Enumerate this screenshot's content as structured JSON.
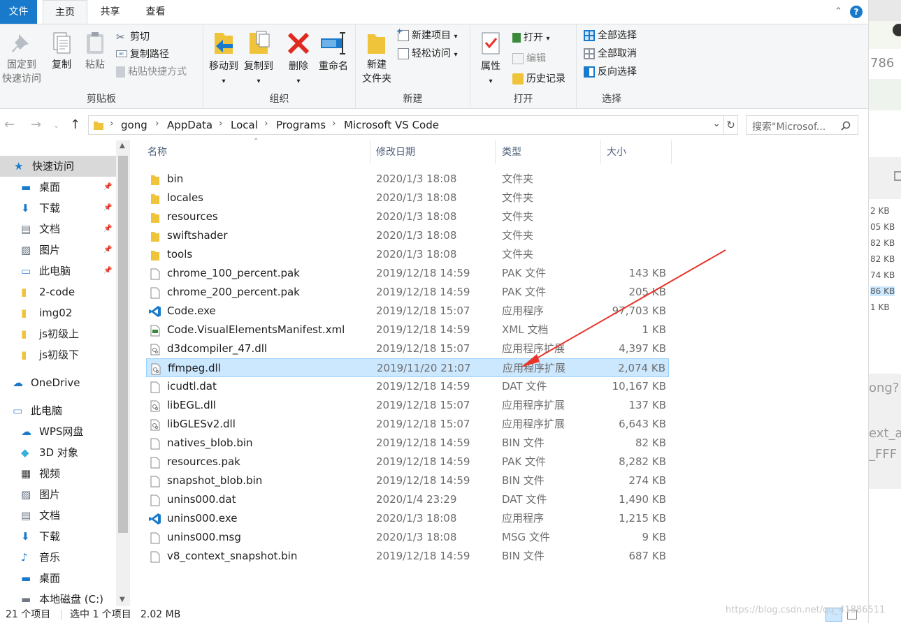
{
  "tabs": {
    "file": "文件",
    "home": "主页",
    "share": "共享",
    "view": "查看"
  },
  "ribbon": {
    "clipboard": {
      "title": "剪贴板",
      "pin_line1": "固定到",
      "pin_line2": "快速访问",
      "copy": "复制",
      "paste": "粘贴",
      "cut": "剪切",
      "copy_path": "复制路径",
      "paste_shortcut": "粘贴快捷方式"
    },
    "organize": {
      "title": "组织",
      "move_to": "移动到",
      "copy_to": "复制到",
      "delete": "删除",
      "rename": "重命名"
    },
    "new": {
      "title": "新建",
      "new_folder_line1": "新建",
      "new_folder_line2": "文件夹",
      "new_item": "新建项目",
      "easy_access": "轻松访问"
    },
    "open": {
      "title": "打开",
      "properties": "属性",
      "open": "打开",
      "edit": "编辑",
      "history": "历史记录"
    },
    "select": {
      "title": "选择",
      "select_all": "全部选择",
      "select_none": "全部取消",
      "invert": "反向选择"
    }
  },
  "address": {
    "crumbs": [
      "gong",
      "AppData",
      "Local",
      "Programs",
      "Microsoft VS Code"
    ],
    "search_placeholder": "搜索\"Microsof..."
  },
  "nav": [
    {
      "label": "快速访问",
      "icon": "star-icon"
    },
    {
      "label": "桌面",
      "icon": "desktop-icon",
      "pinned": true
    },
    {
      "label": "下载",
      "icon": "download-icon",
      "pinned": true
    },
    {
      "label": "文档",
      "icon": "document-icon",
      "pinned": true
    },
    {
      "label": "图片",
      "icon": "picture-icon",
      "pinned": true
    },
    {
      "label": "此电脑",
      "icon": "computer-icon",
      "pinned": true
    },
    {
      "label": "2-code",
      "icon": "folder-icon"
    },
    {
      "label": "img02",
      "icon": "folder-icon"
    },
    {
      "label": "js初级上",
      "icon": "folder-icon"
    },
    {
      "label": "js初级下",
      "icon": "folder-icon"
    },
    {
      "label": "OneDrive",
      "icon": "cloud-icon"
    },
    {
      "label": "此电脑",
      "icon": "computer-icon"
    },
    {
      "label": "WPS网盘",
      "icon": "cloud-icon"
    },
    {
      "label": "3D 对象",
      "icon": "cube-icon"
    },
    {
      "label": "视频",
      "icon": "video-icon"
    },
    {
      "label": "图片",
      "icon": "picture-icon"
    },
    {
      "label": "文档",
      "icon": "document-icon"
    },
    {
      "label": "下载",
      "icon": "download-icon"
    },
    {
      "label": "音乐",
      "icon": "music-icon"
    },
    {
      "label": "桌面",
      "icon": "desktop-icon"
    },
    {
      "label": "本地磁盘 (C:)",
      "icon": "drive-icon"
    }
  ],
  "columns": {
    "name": "名称",
    "date": "修改日期",
    "type": "类型",
    "size": "大小"
  },
  "files": [
    {
      "name": "bin",
      "date": "2020/1/3 18:08",
      "type": "文件夹",
      "size": "",
      "icon": "folder"
    },
    {
      "name": "locales",
      "date": "2020/1/3 18:08",
      "type": "文件夹",
      "size": "",
      "icon": "folder"
    },
    {
      "name": "resources",
      "date": "2020/1/3 18:08",
      "type": "文件夹",
      "size": "",
      "icon": "folder"
    },
    {
      "name": "swiftshader",
      "date": "2020/1/3 18:08",
      "type": "文件夹",
      "size": "",
      "icon": "folder"
    },
    {
      "name": "tools",
      "date": "2020/1/3 18:08",
      "type": "文件夹",
      "size": "",
      "icon": "folder"
    },
    {
      "name": "chrome_100_percent.pak",
      "date": "2019/12/18 14:59",
      "type": "PAK 文件",
      "size": "143 KB",
      "icon": "file"
    },
    {
      "name": "chrome_200_percent.pak",
      "date": "2019/12/18 14:59",
      "type": "PAK 文件",
      "size": "205 KB",
      "icon": "file"
    },
    {
      "name": "Code.exe",
      "date": "2019/12/18 15:07",
      "type": "应用程序",
      "size": "97,703 KB",
      "icon": "vscode"
    },
    {
      "name": "Code.VisualElementsManifest.xml",
      "date": "2019/12/18 14:59",
      "type": "XML 文档",
      "size": "1 KB",
      "icon": "xml"
    },
    {
      "name": "d3dcompiler_47.dll",
      "date": "2019/12/18 15:07",
      "type": "应用程序扩展",
      "size": "4,397 KB",
      "icon": "dll"
    },
    {
      "name": "ffmpeg.dll",
      "date": "2019/11/20 21:07",
      "type": "应用程序扩展",
      "size": "2,074 KB",
      "icon": "dll",
      "selected": true
    },
    {
      "name": "icudtl.dat",
      "date": "2019/12/18 14:59",
      "type": "DAT 文件",
      "size": "10,167 KB",
      "icon": "file"
    },
    {
      "name": "libEGL.dll",
      "date": "2019/12/18 15:07",
      "type": "应用程序扩展",
      "size": "137 KB",
      "icon": "dll"
    },
    {
      "name": "libGLESv2.dll",
      "date": "2019/12/18 15:07",
      "type": "应用程序扩展",
      "size": "6,643 KB",
      "icon": "dll"
    },
    {
      "name": "natives_blob.bin",
      "date": "2019/12/18 14:59",
      "type": "BIN 文件",
      "size": "82 KB",
      "icon": "file"
    },
    {
      "name": "resources.pak",
      "date": "2019/12/18 14:59",
      "type": "PAK 文件",
      "size": "8,282 KB",
      "icon": "file"
    },
    {
      "name": "snapshot_blob.bin",
      "date": "2019/12/18 14:59",
      "type": "BIN 文件",
      "size": "274 KB",
      "icon": "file"
    },
    {
      "name": "unins000.dat",
      "date": "2020/1/4 23:29",
      "type": "DAT 文件",
      "size": "1,490 KB",
      "icon": "file"
    },
    {
      "name": "unins000.exe",
      "date": "2020/1/3 18:08",
      "type": "应用程序",
      "size": "1,215 KB",
      "icon": "vscode"
    },
    {
      "name": "unins000.msg",
      "date": "2020/1/3 18:08",
      "type": "MSG 文件",
      "size": "9 KB",
      "icon": "file"
    },
    {
      "name": "v8_context_snapshot.bin",
      "date": "2019/12/18 14:59",
      "type": "BIN 文件",
      "size": "687 KB",
      "icon": "file"
    }
  ],
  "status": {
    "count": "21 个项目",
    "selection": "选中 1 个项目",
    "size": "2.02 MB"
  },
  "background_app": {
    "num": "786",
    "sizes": [
      "2 KB",
      "05 KB",
      "82 KB",
      "82 KB",
      "74 KB",
      "86 KB",
      "1 KB"
    ],
    "q": "ong?",
    "t1": "ext_a",
    "t2": "_FFF"
  },
  "watermark": "https://blog.csdn.net/qq_41886511",
  "colors": {
    "accent": "#1979ca",
    "selection": "#cce8ff",
    "arrow": "#e8352a"
  }
}
